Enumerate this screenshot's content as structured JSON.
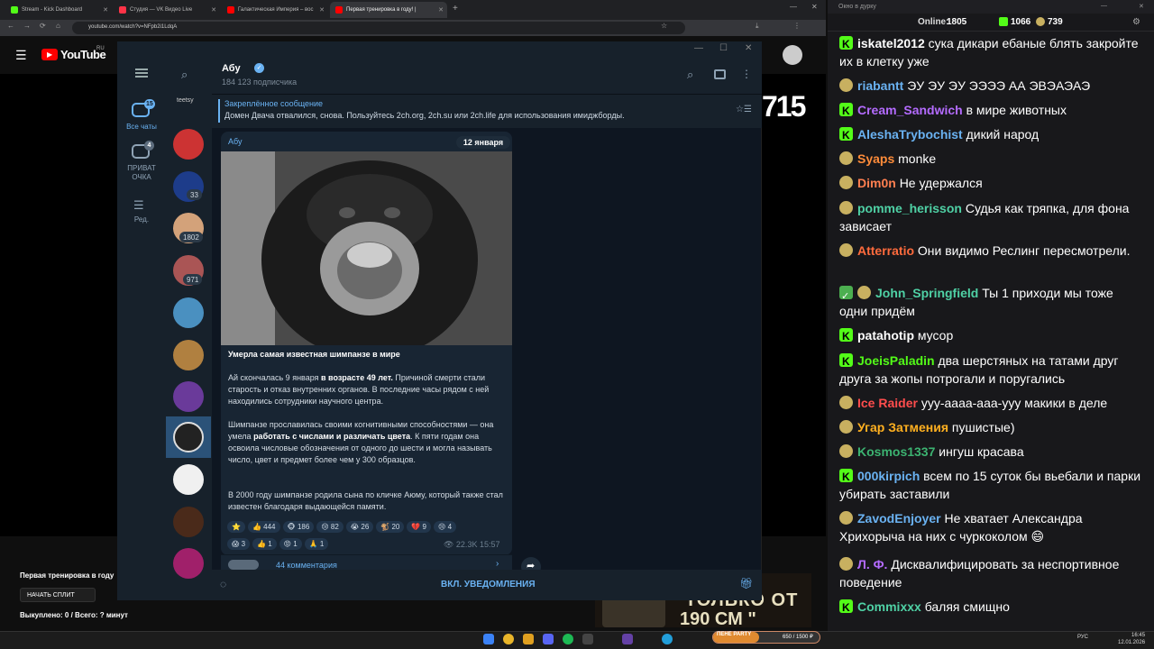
{
  "browser": {
    "tabs": [
      {
        "label": "Stream - Kick Dashboard",
        "color": "#53fc18"
      },
      {
        "label": "Студия — VK Видео Live",
        "color": "#ff3347"
      },
      {
        "label": "Галактическая Империя – вос",
        "color": "#ff0000"
      },
      {
        "label": "Первая тренировка в году! |",
        "color": "#ff0000"
      }
    ],
    "url": "youtube.com/watch?v=NFpb2i1LdqA"
  },
  "youtube": {
    "logo": "YouTube",
    "region": "RU",
    "counter": "715",
    "promo_line": "ТОЛЬКО ОТ",
    "promo_line2": "190 СМ \"",
    "promo_badge": "ПЕНЕ PARTY",
    "below_title": "Первая тренировка в году",
    "split_button": "НАЧАТЬ СПЛИТ",
    "bought": "Выкуплено: 0 / Всего: ? минут"
  },
  "telegram": {
    "rail": [
      {
        "label": "Все чаты",
        "badge": "15",
        "active": true
      },
      {
        "label": "ПРИВАТ ОЧКА",
        "badge": "4",
        "active": false
      },
      {
        "label": "Ред.",
        "badge": "",
        "active": false
      }
    ],
    "chat_top_label": "teetsy",
    "chat_badges": [
      "33",
      "1802",
      "971"
    ],
    "channel_name": "Абу",
    "subscribers": "184 123 подписчика",
    "pinned_label": "Закреплённое сообщение",
    "pinned_text": "Домен Двача отвалился, снова.  Пользуйтесь 2ch.org, 2ch.su или 2ch.life для использования имиджборды.",
    "message": {
      "author": "Абу",
      "date": "12 января",
      "title": "Умерла самая известная шимпанзе в мире",
      "p1_a": "Ай скончалась 9 января ",
      "p1_b": "в возрасте 49 лет.",
      "p1_c": " Причиной смерти стали старость и отказ внутренних органов. В последние часы рядом с ней находились сотрудники научного центра.",
      "p2_a": "Шимпанзе прославилась своими когнитивными способностями — она умела ",
      "p2_b": "работать с числами и различать цвета",
      "p2_c": ". К пяти годам она освоила числовые обозначения от одного до шести и могла называть число, цвет и предмет более чем у 300 образцов.",
      "p3": "В 2000 году шимпанзе родила сына по кличке Аюму, который также стал известен благодаря выдающейся памяти.",
      "reactions_row1": [
        "⭐",
        "👍 444",
        "🐵 186",
        "😢 82",
        "😭 26",
        "🐒 20",
        "💔 9",
        "😢 4"
      ],
      "reactions_row2": [
        "😱 3",
        "👍 1",
        "😡 1",
        "🙏 1"
      ],
      "views": "👁 22.3K  15:57",
      "comments": "44 комментария"
    },
    "bottom_button": "ВКЛ. УВЕДОМЛЕНИЯ"
  },
  "chat": {
    "window_title": "Окно в дурку",
    "online_label": "Online:",
    "online_value": "1805",
    "kick_count": "1066",
    "yt_count": "739",
    "messages": [
      {
        "badge": "k",
        "user": "iskatel2012",
        "color": "#ffffff",
        "text": "сука дикари ебаные блять закройте их в клетку уже"
      },
      {
        "badge": "y",
        "user": "riabantt",
        "color": "#6ab2f2",
        "text": "ЭУ ЭУ ЭУ ЭЭЭЭ АА ЭВЭАЭАЭ"
      },
      {
        "badge": "k",
        "user": "Cream_Sandwich",
        "color": "#b46bff",
        "text": "в мире животных"
      },
      {
        "badge": "k",
        "user": "AleshaTrybochist",
        "color": "#6ab2f2",
        "text": "дикий народ"
      },
      {
        "badge": "y",
        "user": "Syaps",
        "color": "#ff8c3a",
        "text": "monke"
      },
      {
        "badge": "y",
        "user": "Dim0n",
        "color": "#ff7f50",
        "text": "Не удержался"
      },
      {
        "badge": "y",
        "user": "pomme_herisson",
        "color": "#4fd1a5",
        "text": "Судья как тряпка, для фона зависает"
      },
      {
        "badge": "y",
        "user": "Atterratio",
        "color": "#ff6b3d",
        "text": "Они видимо Реслинг пересмотрели."
      },
      {
        "badge": "cy",
        "user": "John_Springfield",
        "color": "#4fd1a5",
        "text": "Ты 1 приходи мы тоже одни придём"
      },
      {
        "badge": "k",
        "user": "patahotip",
        "color": "#ffffff",
        "text": "мусор"
      },
      {
        "badge": "k",
        "user": "JoeisPaladin",
        "color": "#53fc18",
        "text": "два шерстяных на татами друг друга за жопы потрогали и поругались"
      },
      {
        "badge": "y",
        "user": "Ice Raider",
        "color": "#ff4d4d",
        "text": "ууу-аааа-ааа-ууу макики в деле"
      },
      {
        "badge": "y",
        "user": "Угар Затмения",
        "color": "#ffb020",
        "text": "пушистые)"
      },
      {
        "badge": "y",
        "user": "Kosmos1337",
        "color": "#3cb371",
        "text": "ингуш красава"
      },
      {
        "badge": "k",
        "user": "000kirpich",
        "color": "#6ab2f2",
        "text": "всем по 15 суток бы вьебали и парки убирать заставили"
      },
      {
        "badge": "y",
        "user": "ZavodEnjoyer",
        "color": "#6ab2f2",
        "text": "Не хватает Александра Хрихорыча на них с чуркоколом 😄"
      },
      {
        "badge": "y",
        "user": "Л. Ф.",
        "color": "#b46bff",
        "text": "Дисквалифицировать за неспортивное поведение"
      },
      {
        "badge": "k",
        "user": "Commixxx",
        "color": "#4fd1a5",
        "text": "баляя смищно"
      }
    ]
  },
  "taskbar": {
    "lang": "РУС",
    "time": "16:45",
    "date": "12.01.2026",
    "progress": "650 / 1500 ₽"
  }
}
